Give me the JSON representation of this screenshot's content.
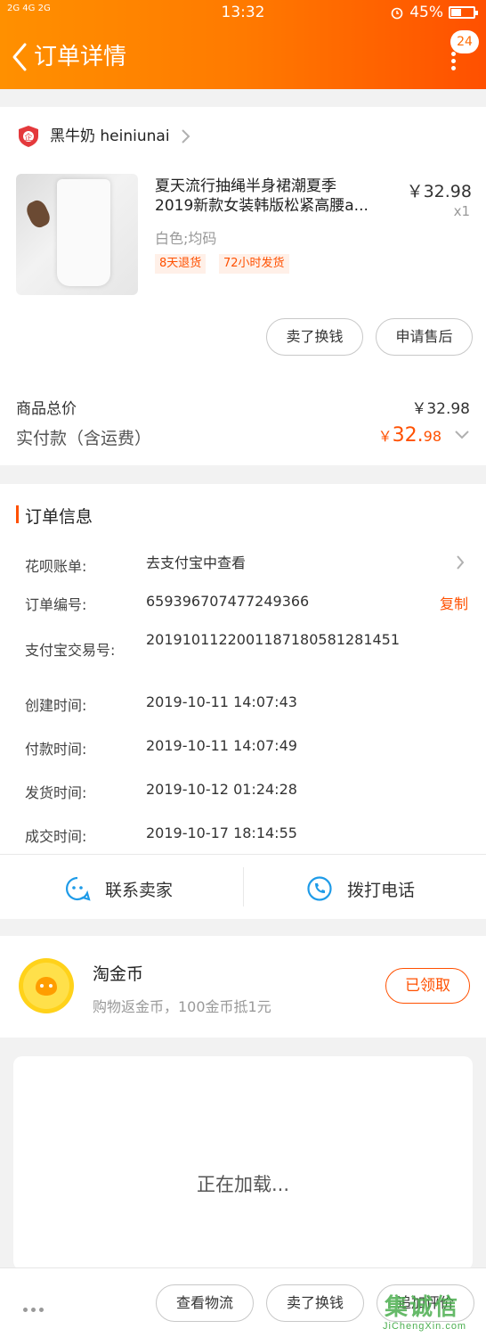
{
  "status_bar": {
    "signal_left": "2G 4G 2G",
    "time": "13:32",
    "battery": "45%"
  },
  "header": {
    "title": "订单详情",
    "badge_count": "24"
  },
  "shop": {
    "name": "黑牛奶 heiniunai"
  },
  "item": {
    "title_line1": "夏天流行抽绳半身裙潮夏季",
    "title_line2": "2019新款女装韩版松紧高腰a...",
    "price": "￥32.98",
    "quantity": "x1",
    "spec": "白色;均码",
    "tags": [
      "8天退货",
      "72小时发货"
    ],
    "actions": [
      "卖了换钱",
      "申请售后"
    ]
  },
  "totals": {
    "goods_total_label": "商品总价",
    "goods_total_value": "￥32.98",
    "paid_label": "实付款（含运费）",
    "paid_currency": "￥",
    "paid_int": "32.",
    "paid_dec": "98"
  },
  "order_info": {
    "title": "订单信息",
    "rows": [
      {
        "label": "花呗账单:",
        "value": "去支付宝中查看"
      },
      {
        "label": "订单编号:",
        "value": "659396707477249366",
        "action": "复制"
      },
      {
        "label": "支付宝交易号:",
        "value": "2019101122001187180581281451"
      },
      {
        "label": "创建时间:",
        "value": "2019-10-11 14:07:43"
      },
      {
        "label": "付款时间:",
        "value": "2019-10-11 14:07:49"
      },
      {
        "label": "发货时间:",
        "value": "2019-10-12 01:24:28"
      },
      {
        "label": "成交时间:",
        "value": "2019-10-17 18:14:55"
      }
    ],
    "contact_seller": "联系卖家",
    "call_phone": "拨打电话"
  },
  "coins": {
    "title": "淘金币",
    "subtitle": "购物返金币，100金币抵1元",
    "button": "已领取"
  },
  "loading_text": "正在加载...",
  "bottom_bar": {
    "buttons": [
      "查看物流",
      "卖了换钱",
      "追加评价"
    ]
  },
  "watermark": {
    "logo": "集诚信",
    "text": "JiChengXin.com"
  },
  "colors": {
    "accent": "#ff5000",
    "header_start": "#ff9000",
    "header_end": "#ff5000",
    "link_blue": "#1e9be8"
  }
}
